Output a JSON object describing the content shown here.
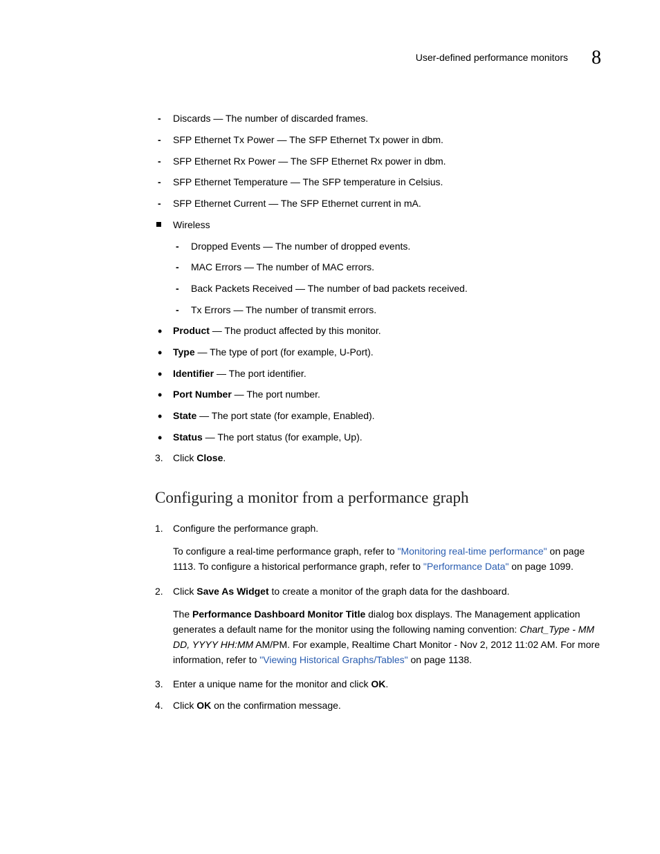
{
  "header": {
    "title": "User-defined performance monitors",
    "chapter": "8"
  },
  "dash1": [
    "Discards — The number of discarded frames.",
    "SFP Ethernet Tx Power — The SFP Ethernet Tx power in dbm.",
    "SFP Ethernet Rx Power — The SFP Ethernet Rx power in dbm.",
    "SFP Ethernet Temperature — The SFP temperature in Celsius.",
    "SFP Ethernet Current — The SFP Ethernet current in mA."
  ],
  "wireless_label": "Wireless",
  "dash2": [
    "Dropped Events — The number of dropped events.",
    "MAC Errors — The number of MAC errors.",
    "Back Packets Received — The number of bad packets received.",
    "Tx Errors — The number of transmit errors."
  ],
  "disc_items": [
    {
      "term": "Product",
      "desc": " — The product affected by this monitor."
    },
    {
      "term": "Type",
      "desc": " — The type of port (for example, U-Port)."
    },
    {
      "term": "Identifier",
      "desc": " — The port identifier."
    },
    {
      "term": "Port Number",
      "desc": " — The port number."
    },
    {
      "term": "State",
      "desc": " — The port state (for example, Enabled)."
    },
    {
      "term": "Status",
      "desc": " — The port status (for example, Up)."
    }
  ],
  "step3_pre": "Click ",
  "step3_bold": "Close",
  "step3_post": ".",
  "h2": "Configuring a monitor from a performance graph",
  "sec2": {
    "s1": {
      "text": "Configure the performance graph.",
      "p1a": "To configure a real-time performance graph, refer to ",
      "link1": "\"Monitoring real-time performance\"",
      "p1b": " on page 1113. To configure a historical performance graph, refer to ",
      "link2": "\"Performance Data\"",
      "p1c": " on page 1099."
    },
    "s2": {
      "pre": "Click ",
      "bold": "Save As Widget",
      "post": " to create a monitor of the graph data for the dashboard.",
      "p2a": "The ",
      "p2bold": "Performance Dashboard Monitor Title",
      "p2b": " dialog box displays. The Management application generates a default name for the monitor using the following naming convention: ",
      "p2italic": "Chart_Type - MM DD, YYYY HH:MM",
      "p2c": " AM/PM. For example, Realtime Chart Monitor - Nov 2, 2012 11:02 AM. For more information, refer to ",
      "link3": "\"Viewing Historical Graphs/Tables\"",
      "p2d": " on page 1138."
    },
    "s3": {
      "pre": "Enter a unique name for the monitor and click ",
      "bold": "OK",
      "post": "."
    },
    "s4": {
      "pre": "Click ",
      "bold": "OK",
      "post": " on the confirmation message."
    }
  }
}
